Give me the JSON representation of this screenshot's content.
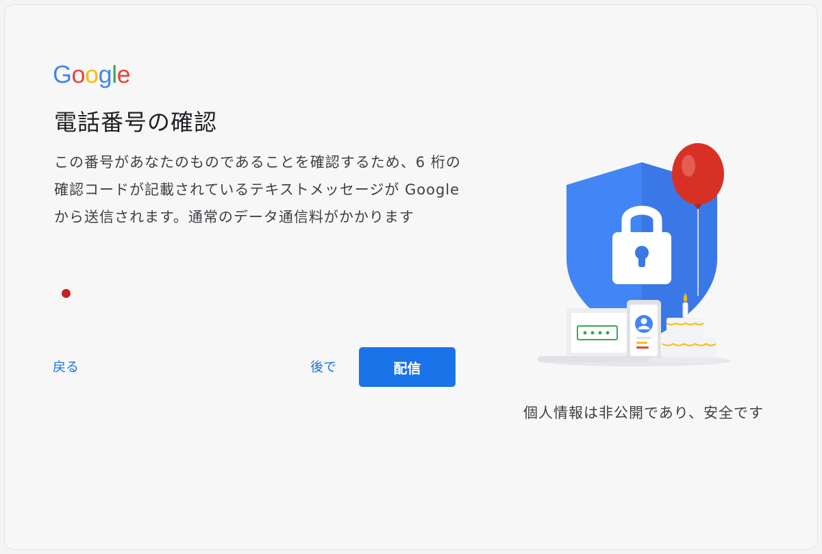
{
  "brand": {
    "logo_letters": [
      "G",
      "o",
      "o",
      "g",
      "l",
      "e"
    ],
    "logo_colors": [
      "#4285f4",
      "#ea4335",
      "#fbbc05",
      "#4285f4",
      "#34a853",
      "#ea4335"
    ]
  },
  "page": {
    "title": "電話番号の確認",
    "description": "この番号があなたのものであることを確認するため、6 桁の確認コードが記載されているテキストメッセージが Google から送信されます。通常のデータ通信料がかかります"
  },
  "status_dot": {
    "color": "#c5221f"
  },
  "actions": {
    "back_label": "戻る",
    "later_label": "後で",
    "send_label": "配信",
    "link_color": "#1a73e8",
    "button_color": "#1a73e8"
  },
  "illustration": {
    "icons": [
      "shield-icon",
      "lock-icon",
      "balloon-icon",
      "laptop-icon",
      "phone-icon",
      "cake-icon"
    ]
  },
  "privacy_caption": "個人情報は非公開であり、安全です"
}
